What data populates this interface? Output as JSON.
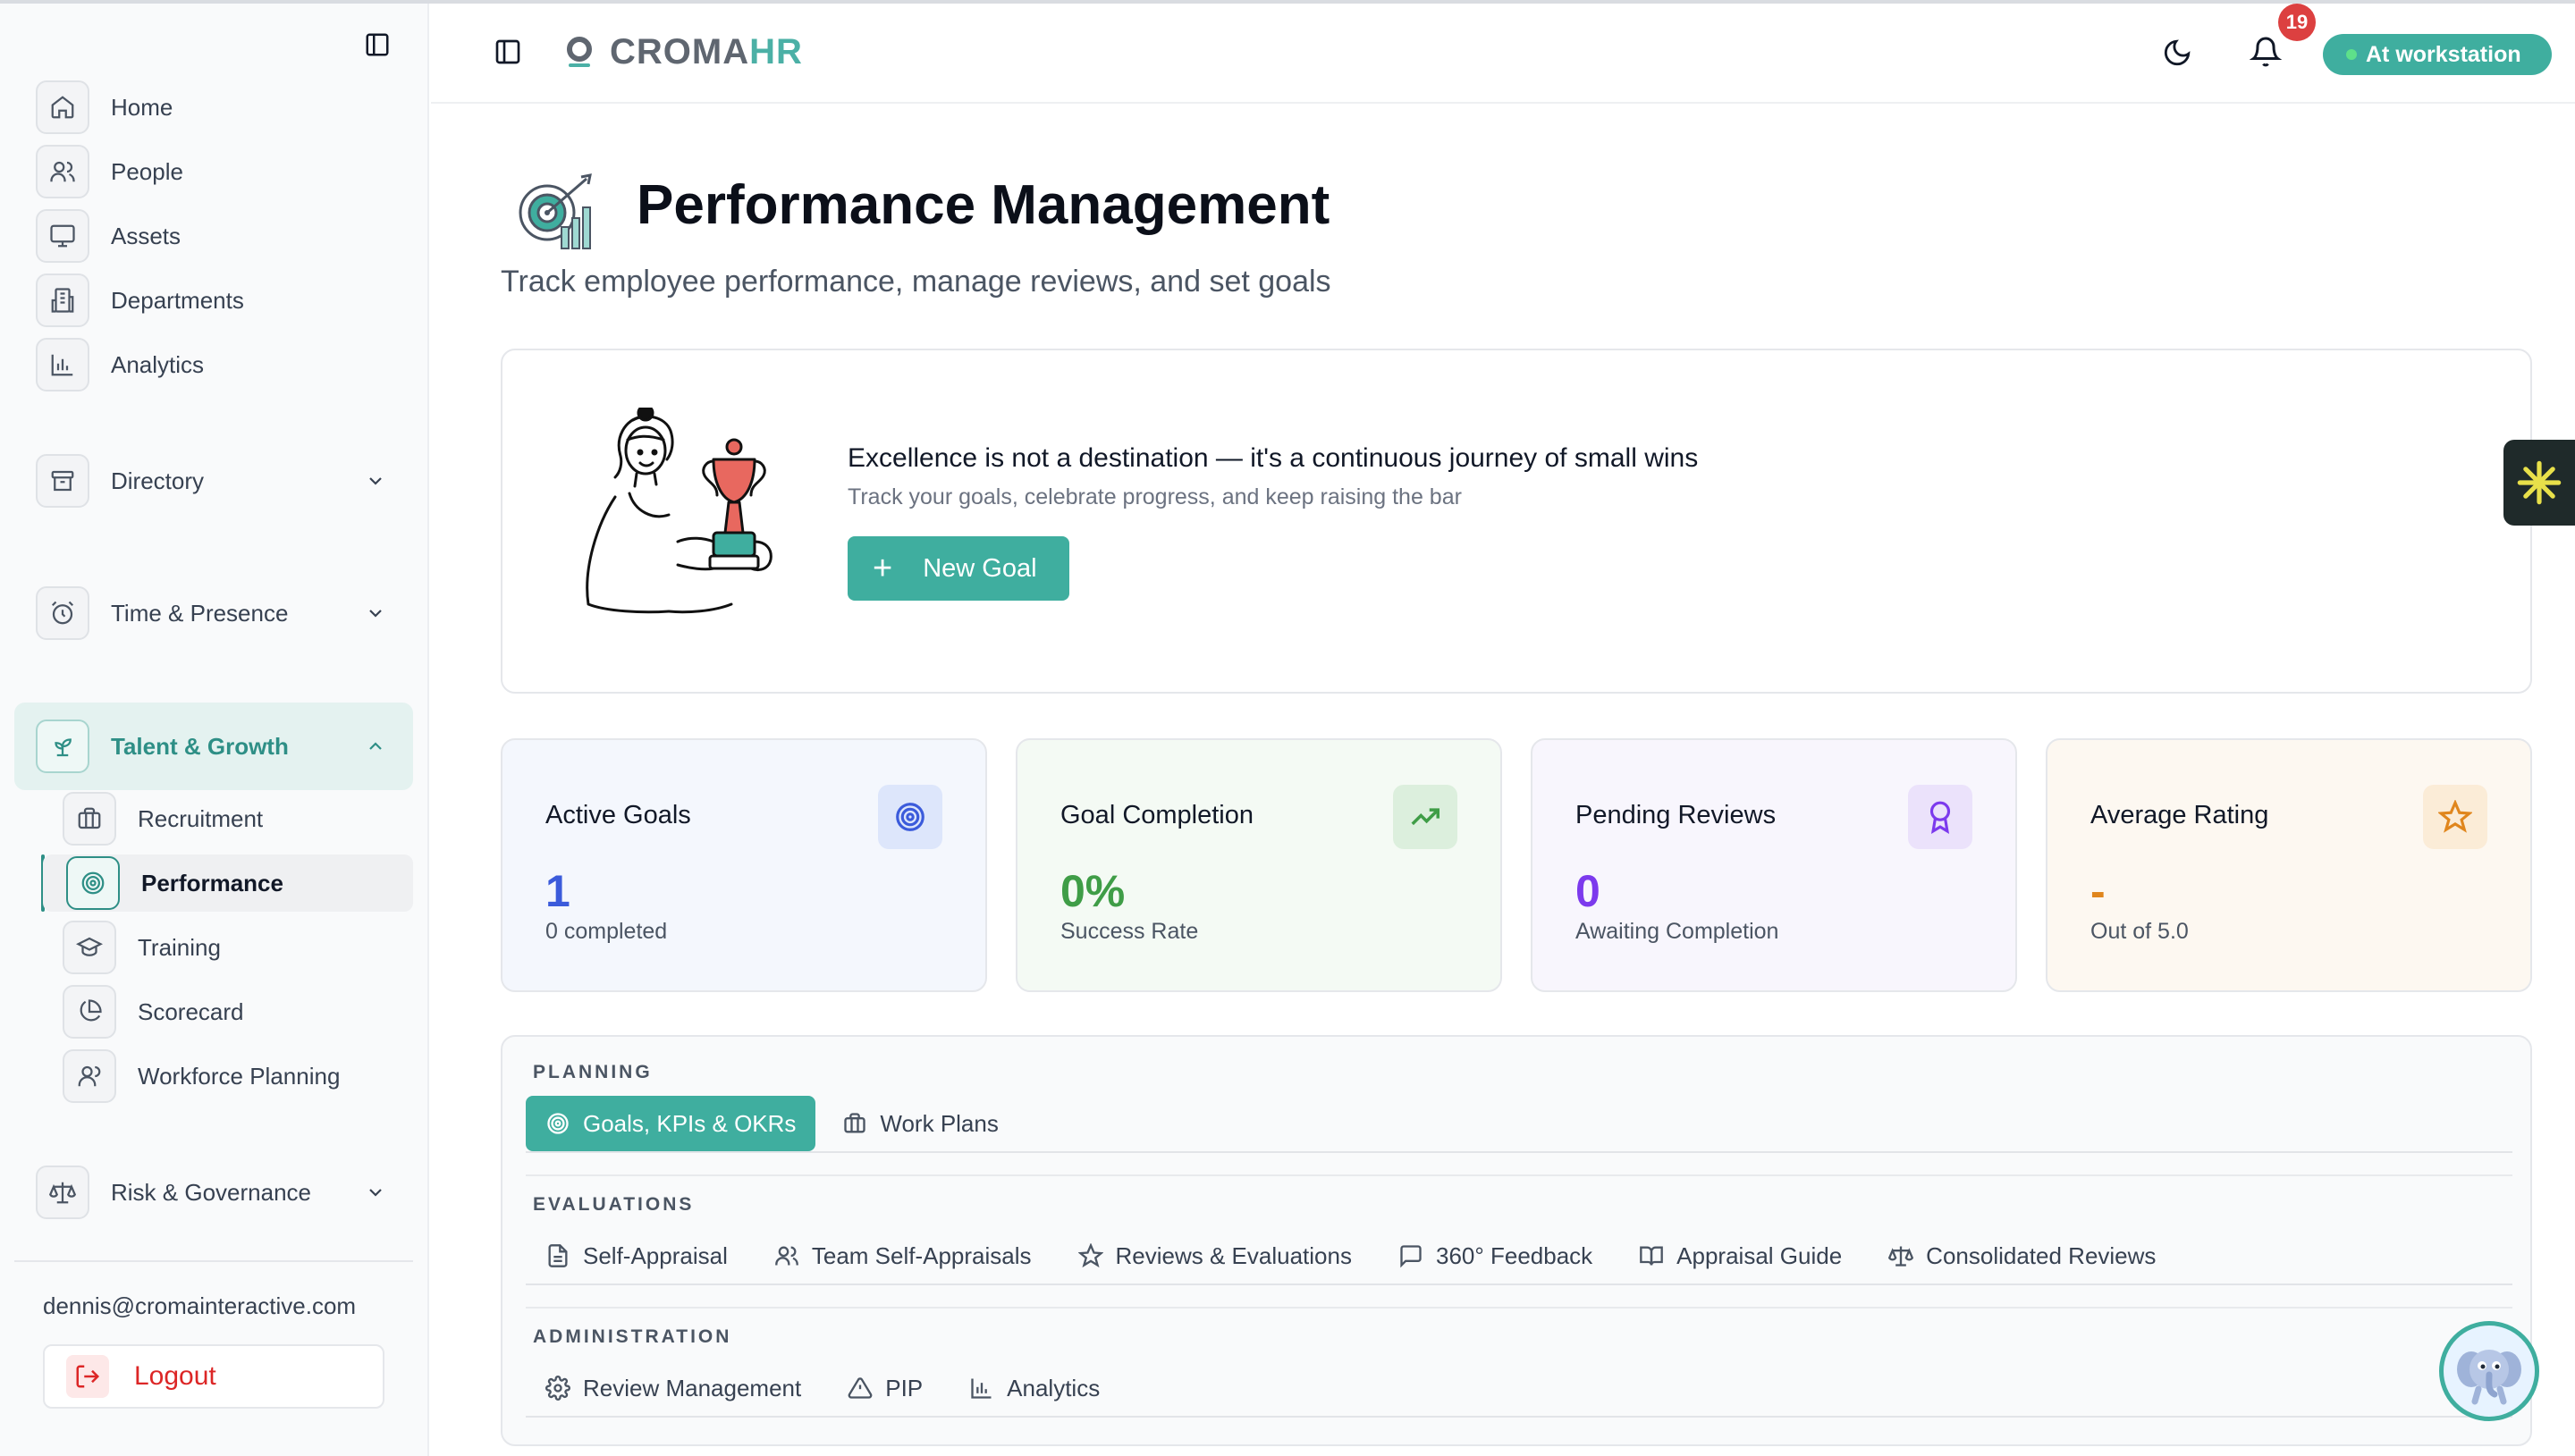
{
  "sidebar": {
    "items": [
      {
        "label": "Home",
        "icon": "home-icon"
      },
      {
        "label": "People",
        "icon": "users-icon"
      },
      {
        "label": "Assets",
        "icon": "monitor-icon"
      },
      {
        "label": "Departments",
        "icon": "building-icon"
      },
      {
        "label": "Analytics",
        "icon": "bar-chart-icon"
      }
    ],
    "groups": {
      "directory": "Directory",
      "time": "Time & Presence",
      "talent": "Talent & Growth",
      "risk": "Risk & Governance"
    },
    "talent_items": [
      {
        "label": "Recruitment",
        "icon": "briefcase-icon"
      },
      {
        "label": "Performance",
        "icon": "target-icon"
      },
      {
        "label": "Training",
        "icon": "graduation-cap-icon"
      },
      {
        "label": "Scorecard",
        "icon": "pie-chart-icon"
      },
      {
        "label": "Workforce Planning",
        "icon": "users-icon"
      }
    ],
    "user_email": "dennis@cromainteractive.com",
    "logout_label": "Logout"
  },
  "header": {
    "logo_part1": "CROMA",
    "logo_part2": "HR",
    "notification_count": "19",
    "status_label": "At workstation",
    "accent": "#3fae9f"
  },
  "page": {
    "title": "Performance Management",
    "subtitle": "Track employee performance, manage reviews, and set goals"
  },
  "hero": {
    "quote": "Excellence is not a destination — it's a continuous journey of small wins",
    "sub": "Track your goals, celebrate progress, and keep raising the bar",
    "button": "New Goal"
  },
  "stats": [
    {
      "label": "Active Goals",
      "value": "1",
      "sub": "0 completed",
      "color": "#3b5bdb",
      "icon": "target-icon"
    },
    {
      "label": "Goal Completion",
      "value": "0%",
      "sub": "Success Rate",
      "color": "#3f9d47",
      "icon": "trending-up-icon"
    },
    {
      "label": "Pending Reviews",
      "value": "0",
      "sub": "Awaiting Completion",
      "color": "#7c3aed",
      "icon": "award-icon"
    },
    {
      "label": "Average Rating",
      "value": "-",
      "sub": "Out of 5.0",
      "color": "#e0861d",
      "icon": "star-icon"
    }
  ],
  "sections": {
    "planning": {
      "title": "PLANNING",
      "tabs": [
        "Goals, KPIs & OKRs",
        "Work Plans"
      ]
    },
    "evaluations": {
      "title": "EVALUATIONS",
      "tabs": [
        "Self-Appraisal",
        "Team Self-Appraisals",
        "Reviews & Evaluations",
        "360° Feedback",
        "Appraisal Guide",
        "Consolidated Reviews"
      ]
    },
    "administration": {
      "title": "ADMINISTRATION",
      "tabs": [
        "Review Management",
        "PIP",
        "Analytics"
      ]
    }
  }
}
